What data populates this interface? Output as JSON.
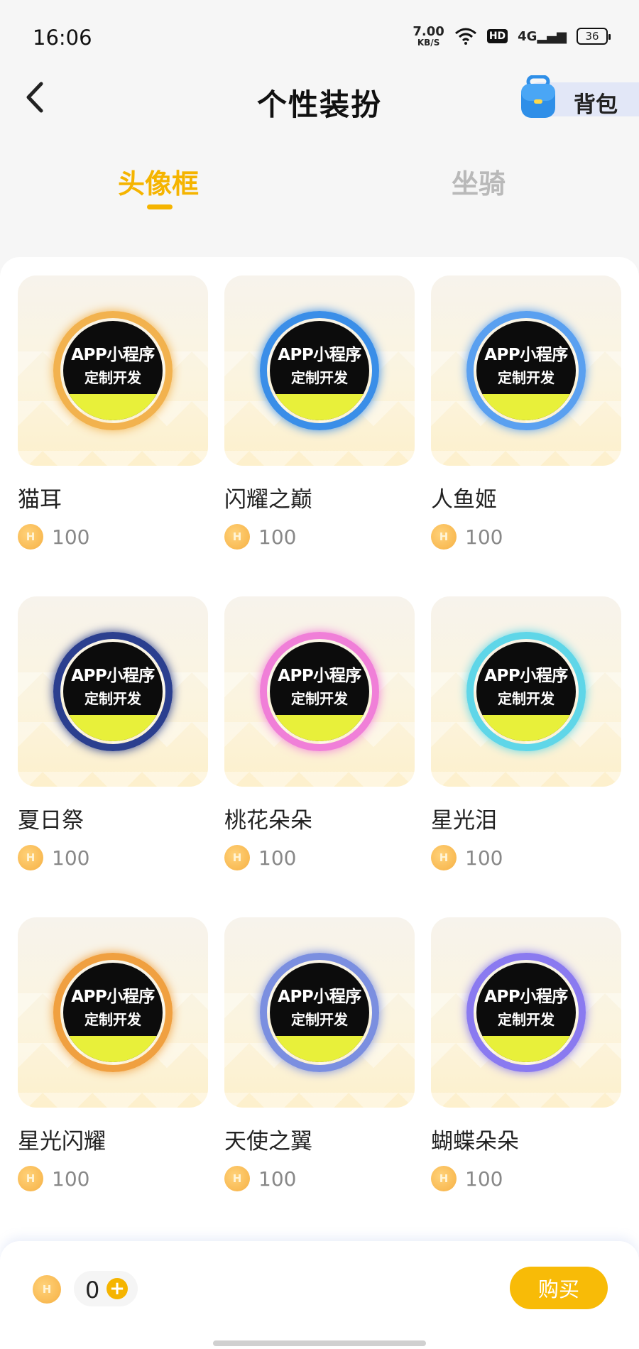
{
  "status_bar": {
    "time": "16:06",
    "net_speed": "7.00",
    "net_unit": "KB/S",
    "hd": "HD",
    "signal": "4G",
    "battery": "36"
  },
  "header": {
    "title": "个性装扮",
    "bag_label": "背包"
  },
  "tabs": [
    {
      "label": "头像框",
      "active": true
    },
    {
      "label": "坐骑",
      "active": false
    }
  ],
  "avatar_text": {
    "line1": "APP小程序",
    "line2": "定制开发"
  },
  "items": [
    {
      "name": "猫耳",
      "price": "100",
      "ring": "#f2b24e"
    },
    {
      "name": "闪耀之巅",
      "price": "100",
      "ring": "#3a8ee8"
    },
    {
      "name": "人鱼姬",
      "price": "100",
      "ring": "#5aa0f0"
    },
    {
      "name": "夏日祭",
      "price": "100",
      "ring": "#2b3f8f"
    },
    {
      "name": "桃花朵朵",
      "price": "100",
      "ring": "#f07fd8"
    },
    {
      "name": "星光泪",
      "price": "100",
      "ring": "#5fd6e8"
    },
    {
      "name": "星光闪耀",
      "price": "100",
      "ring": "#f0a040"
    },
    {
      "name": "天使之翼",
      "price": "100",
      "ring": "#7b8fe0"
    },
    {
      "name": "蝴蝶朵朵",
      "price": "100",
      "ring": "#8a7af0"
    }
  ],
  "bottom": {
    "balance": "0",
    "buy_label": "购买"
  },
  "colors": {
    "accent": "#f5b400",
    "tab_inactive": "#b9b9b9"
  }
}
